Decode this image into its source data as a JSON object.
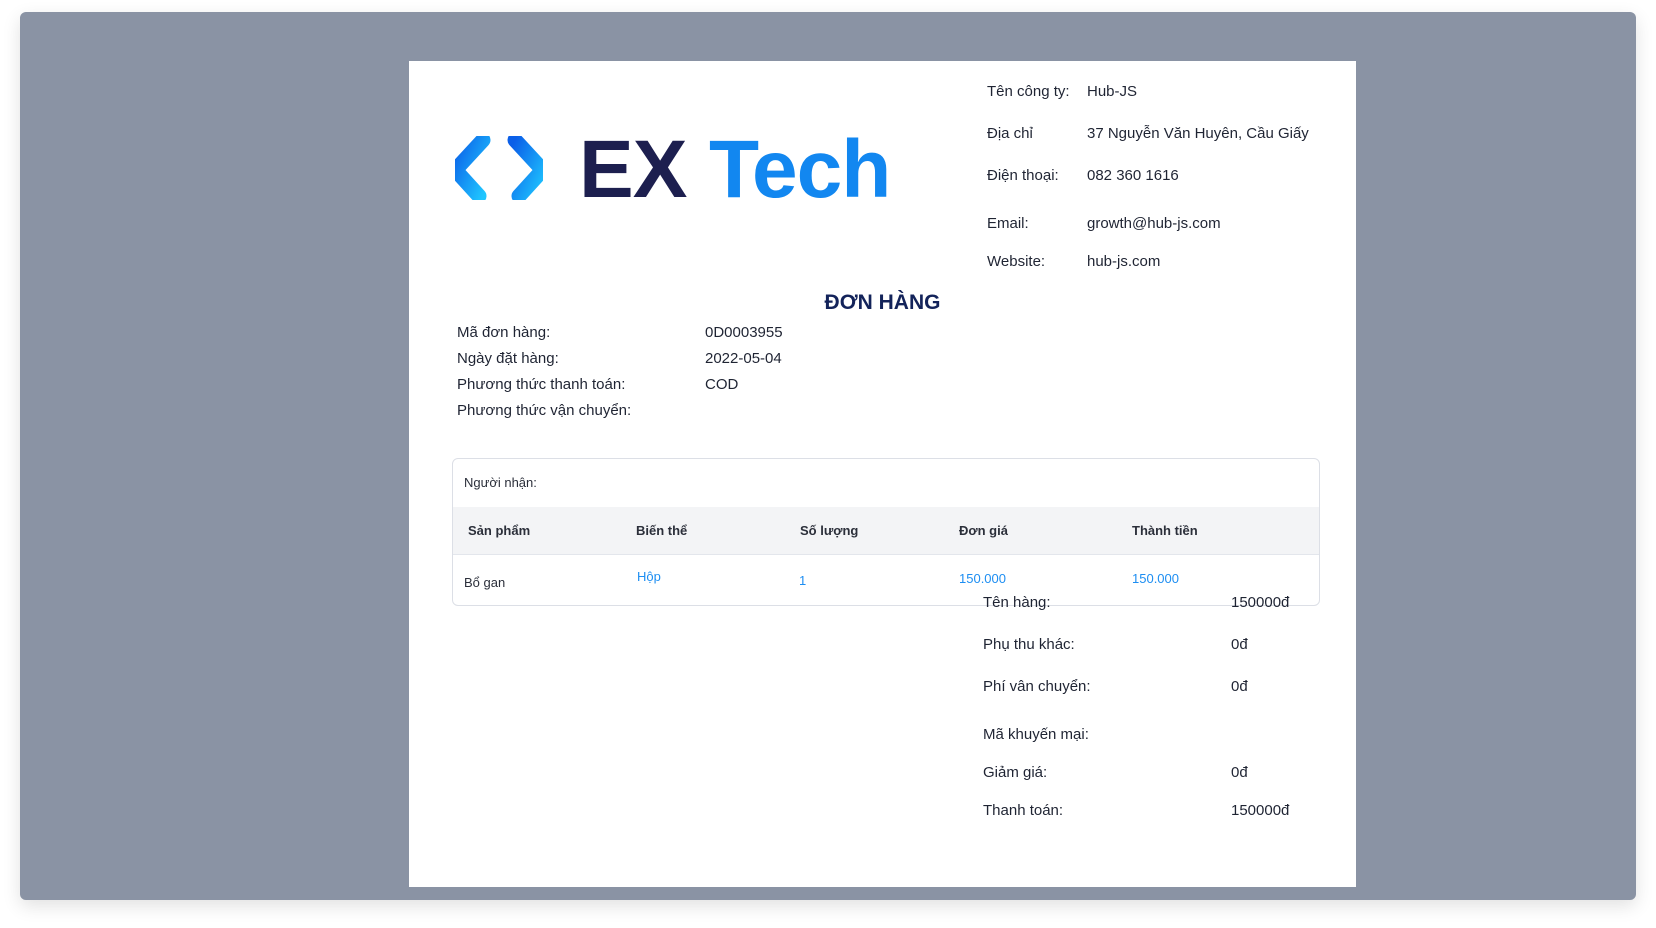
{
  "logo": {
    "part1": "EX",
    "part2": "Tech"
  },
  "company": [
    {
      "label": "Tên công ty:",
      "value": "Hub-JS"
    },
    {
      "label": "Địa chỉ",
      "value": "37 Nguyễn Văn Huyên, Cầu Giấy"
    },
    {
      "label": "Điện thoại:",
      "value": "082 360 1616"
    },
    {
      "label": "Email:",
      "value": "growth@hub-js.com"
    },
    {
      "label": "Website:",
      "value": "hub-js.com"
    }
  ],
  "title": "ĐƠN HÀNG",
  "order": [
    {
      "label": "Mã đơn hàng:",
      "value": "0D0003955"
    },
    {
      "label": "Ngày đặt hàng:",
      "value": "2022-05-04"
    },
    {
      "label": "Phương thức thanh toán:",
      "value": "COD"
    },
    {
      "label": "Phương thức vận chuyển:",
      "value": ""
    }
  ],
  "table": {
    "recipient_label": "Người nhận:",
    "headers": [
      "Sản phẩm",
      "Biến thể",
      "Số lượng",
      "Đơn giá",
      "Thành tiền"
    ],
    "rows": [
      {
        "product": "Bổ gan",
        "variant": "Hộp",
        "quantity": "1",
        "unit_price": "150.000",
        "total": "150.000"
      }
    ]
  },
  "summary": [
    {
      "label": "Tên hàng:",
      "value": "150000đ"
    },
    {
      "label": "Phụ thu khác:",
      "value": "0đ"
    },
    {
      "label": "Phí vân chuyển:",
      "value": "0đ"
    },
    {
      "label": "Mã khuyến mại:",
      "value": ""
    },
    {
      "label": "Giảm giá:",
      "value": "0đ"
    },
    {
      "label": "Thanh toán:",
      "value": "150000đ"
    }
  ],
  "colors": {
    "frame": "#8a93a4",
    "brand_dark": "#1d1f4f",
    "brand_blue": "#1287f0",
    "link_blue": "#1d8ef2"
  }
}
